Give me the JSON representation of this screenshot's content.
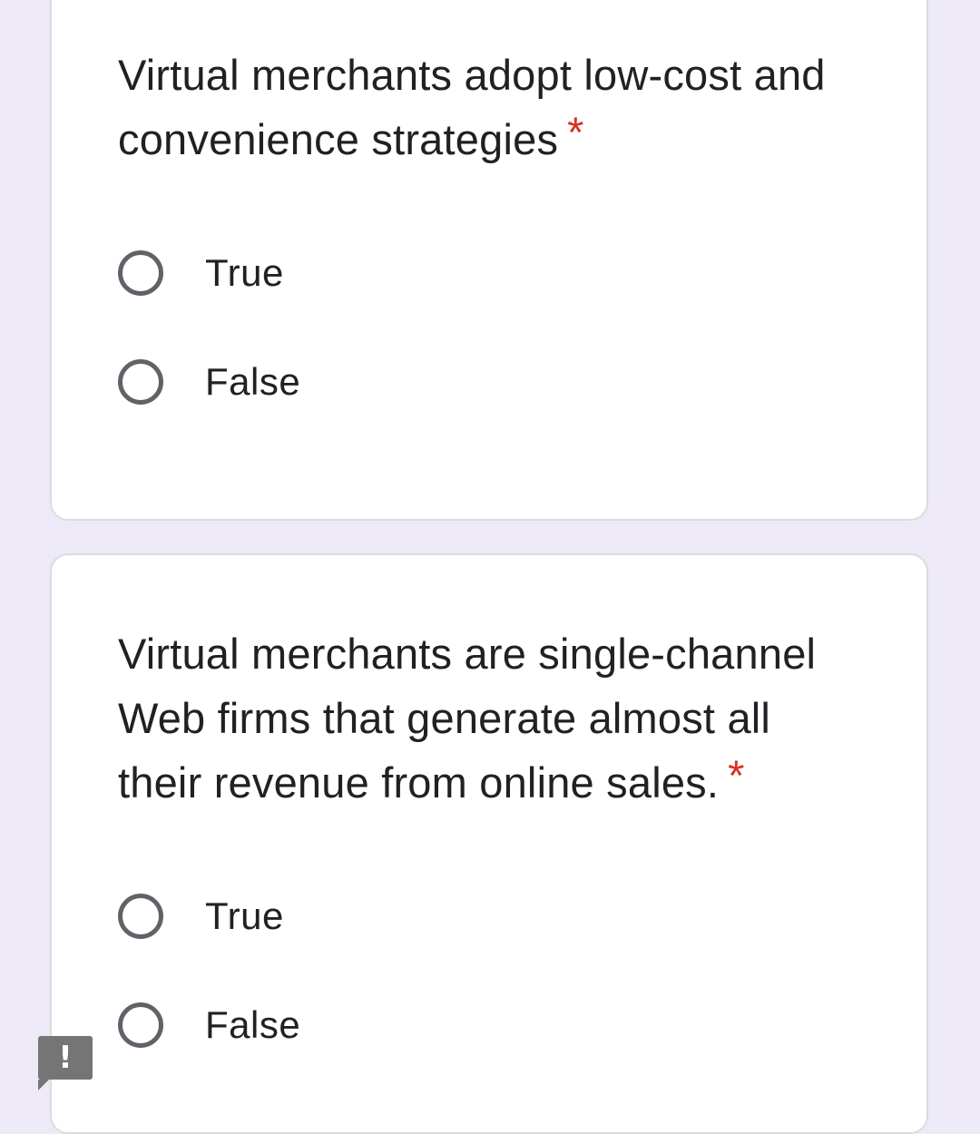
{
  "questions": [
    {
      "text": "Virtual merchants adopt low-cost and convenience strategies",
      "required_marker": "*",
      "options": [
        {
          "label": "True",
          "selected": false
        },
        {
          "label": "False",
          "selected": false
        }
      ]
    },
    {
      "text": "Virtual merchants are single-channel Web firms that generate almost all their revenue from online sales.",
      "required_marker": "*",
      "options": [
        {
          "label": "True",
          "selected": false
        },
        {
          "label": "False",
          "selected": false
        }
      ]
    }
  ],
  "report_button": {
    "icon": "exclamation-icon",
    "glyph": "!"
  },
  "colors": {
    "page_background": "#ede9f6",
    "card_background": "#ffffff",
    "required_marker": "#d93025",
    "radio_outline": "#5f6368",
    "report_button": "#757575"
  }
}
